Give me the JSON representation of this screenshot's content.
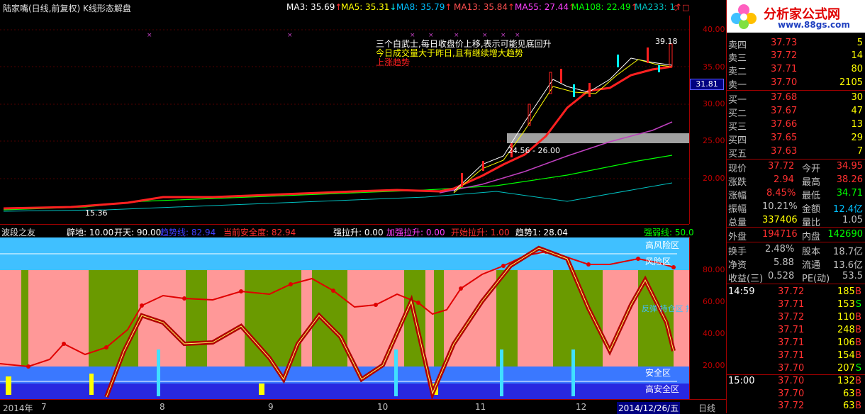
{
  "title": "陆家嘴(日线,前复权) K线形态解盘",
  "ma_legend": [
    {
      "label": "MA3: 35.69",
      "color": "#ffffff",
      "arrow": "↑"
    },
    {
      "label": "MA5: 35.31",
      "color": "#ffff00",
      "arrow": "↓"
    },
    {
      "label": "MA8: 35.79",
      "color": "#00c0ff",
      "arrow": "↑"
    },
    {
      "label": "MA13: 35.84",
      "color": "#ff5050",
      "arrow": "↑"
    },
    {
      "label": "MA55: 27.44",
      "color": "#ff00ff",
      "arrow": "↑"
    },
    {
      "label": "MA108: 22.49",
      "color": "#00ff00",
      "arrow": "↑"
    },
    {
      "label": "MA233: 1",
      "color": "#00c0c0",
      "arrow": "↑"
    }
  ],
  "upper_axis_ticks": [
    "40.00",
    "35.00",
    "30.00",
    "25.00",
    "20.00"
  ],
  "current_price_tag": "31.81",
  "chart_annotations": {
    "text1": "三个白武士,每日收盘价上移,表示可能见底回升",
    "text2": "今日成交量大于昨日,且有继续增大趋势",
    "text3": "上涨趋势",
    "high_label": "39.18",
    "low_label": "15.36",
    "zone_label": "24.56 - 26.00"
  },
  "lower_header": {
    "name": "波段之友",
    "items": [
      {
        "text": "辟地: 10.00",
        "color": "#ffffff"
      },
      {
        "text": "开天: 90.00",
        "color": "#ffffff"
      },
      {
        "text": "趋势线: 82.94",
        "color": "#4040ff"
      },
      {
        "text": "当前安全度: 82.94",
        "color": "#ff3030"
      },
      {
        "text": "强拉升: 0.00",
        "color": "#ffffff"
      },
      {
        "text": "加强拉升: 0.00",
        "color": "#ff40ff"
      },
      {
        "text": "开始拉升: 1.00",
        "color": "#ff3030"
      },
      {
        "text": "趋势1: 28.04",
        "color": "#ffffff"
      },
      {
        "text": "强弱线: 50.0",
        "color": "#00ff00"
      }
    ]
  },
  "lower_axis_ticks": [
    "80.00",
    "60.00",
    "40.00",
    "20.00"
  ],
  "zone_labels": [
    "高风险区",
    "风险区",
    "安全区",
    "高安全区"
  ],
  "rebound_label": "反弹 持仓区 持币",
  "time_axis": [
    "2014年",
    "7",
    "8",
    "9",
    "10",
    "11",
    "12",
    "2014/12/26/五",
    "日线"
  ],
  "right_panel": {
    "logo_text": "分析家公式网",
    "logo_url": "www.88gs.com",
    "sell": [
      {
        "label": "卖四",
        "price": "37.73",
        "vol": "5"
      },
      {
        "label": "卖三",
        "price": "37.72",
        "vol": "14"
      },
      {
        "label": "卖二",
        "price": "37.71",
        "vol": "80"
      },
      {
        "label": "卖一",
        "price": "37.70",
        "vol": "2105"
      }
    ],
    "buy": [
      {
        "label": "买一",
        "price": "37.68",
        "vol": "30"
      },
      {
        "label": "买二",
        "price": "37.67",
        "vol": "47"
      },
      {
        "label": "买三",
        "price": "37.66",
        "vol": "13"
      },
      {
        "label": "买四",
        "price": "37.65",
        "vol": "29"
      },
      {
        "label": "买五",
        "price": "37.63",
        "vol": "7"
      }
    ],
    "stats": [
      {
        "l1": "现价",
        "v1": "37.72",
        "c1": "#ff3030",
        "l2": "今开",
        "v2": "34.95",
        "c2": "#ff3030"
      },
      {
        "l1": "涨跌",
        "v1": "2.94",
        "c1": "#ff3030",
        "l2": "最高",
        "v2": "38.26",
        "c2": "#ff3030"
      },
      {
        "l1": "涨幅",
        "v1": "8.45%",
        "c1": "#ff3030",
        "l2": "最低",
        "v2": "34.71",
        "c2": "#00ff00"
      },
      {
        "l1": "振幅",
        "v1": "10.21%",
        "c1": "#c0c0c0",
        "l2": "金额",
        "v2": "12.4亿",
        "c2": "#00c0ff"
      },
      {
        "l1": "总量",
        "v1": "337406",
        "c1": "#ffff00",
        "l2": "量比",
        "v2": "1.05",
        "c2": "#c0c0c0"
      },
      {
        "l1": "外盘",
        "v1": "194716",
        "c1": "#ff3030",
        "l2": "内盘",
        "v2": "142690",
        "c2": "#00ff00"
      },
      {
        "l1": "换手",
        "v1": "2.48%",
        "c1": "#c0c0c0",
        "l2": "股本",
        "v2": "18.7亿",
        "c2": "#c0c0c0"
      },
      {
        "l1": "净资",
        "v1": "5.88",
        "c1": "#c0c0c0",
        "l2": "流通",
        "v2": "13.6亿",
        "c2": "#c0c0c0"
      },
      {
        "l1": "收益(三)",
        "v1": "0.528",
        "c1": "#c0c0c0",
        "l2": "PE(动)",
        "v2": "53.5",
        "c2": "#c0c0c0"
      }
    ],
    "ticks": [
      {
        "time": "14:59",
        "price": "37.72",
        "vol": "185",
        "bs": "B"
      },
      {
        "time": "",
        "price": "37.71",
        "vol": "153",
        "bs": "S"
      },
      {
        "time": "",
        "price": "37.72",
        "vol": "110",
        "bs": "B"
      },
      {
        "time": "",
        "price": "37.71",
        "vol": "248",
        "bs": "B"
      },
      {
        "time": "",
        "price": "37.71",
        "vol": "106",
        "bs": "B"
      },
      {
        "time": "",
        "price": "37.71",
        "vol": "154",
        "bs": "B"
      },
      {
        "time": "",
        "price": "37.70",
        "vol": "207",
        "bs": "S"
      },
      {
        "time": "15:00",
        "price": "37.70",
        "vol": "132",
        "bs": "B"
      },
      {
        "time": "",
        "price": "37.70",
        "vol": "63",
        "bs": "B"
      },
      {
        "time": "",
        "price": "37.72",
        "vol": "63",
        "bs": "B"
      }
    ]
  }
}
